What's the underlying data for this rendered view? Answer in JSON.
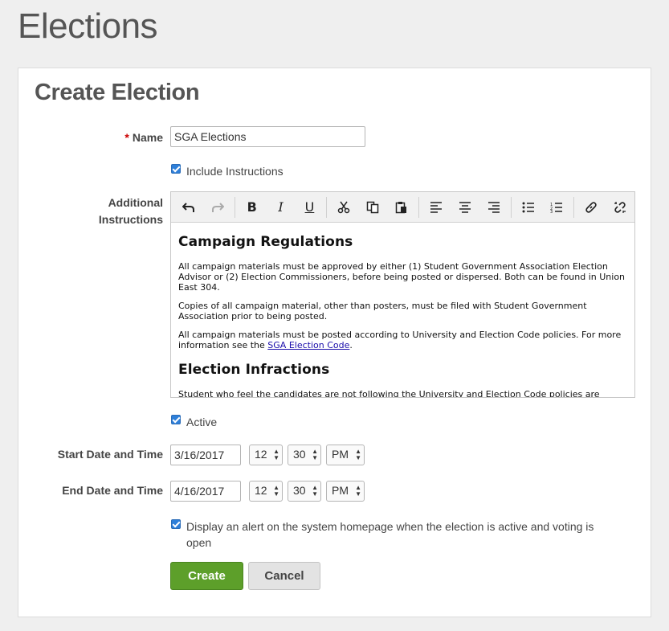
{
  "page": {
    "title": "Elections"
  },
  "form": {
    "title": "Create Election",
    "name": {
      "required_mark": "*",
      "label": "Name",
      "value": "SGA Elections"
    },
    "include_instructions": {
      "label": "Include Instructions",
      "checked": true
    },
    "additional_instructions": {
      "label_line1": "Additional",
      "label_line2": "Instructions",
      "toolbar": [
        "undo-icon",
        "redo-icon",
        "bold-icon",
        "italic-icon",
        "underline-icon",
        "cut-icon",
        "copy-icon",
        "paste-icon",
        "align-left-icon",
        "align-center-icon",
        "align-right-icon",
        "bullet-list-icon",
        "numbered-list-icon",
        "link-icon",
        "unlink-icon"
      ],
      "content": {
        "heading1": "Campaign Regulations",
        "p1": "All campaign materials must be approved by either (1) Student Government Association Election Advisor or (2) Election Commissioners, before being posted or dispersed. Both can be found in Union East 304.",
        "p2": "Copies of all campaign material, other than posters, must be filed with Student Government Association prior to being posted.",
        "p3_before": "All campaign materials must be posted according to University and Election Code policies. For more information see the ",
        "p3_link": "SGA Election Code",
        "p3_after": ".",
        "heading2": "Election Infractions",
        "p4": "Student who feel the candidates are not following the University and Election Code policies are"
      }
    },
    "active": {
      "label": "Active",
      "checked": true
    },
    "start": {
      "label": "Start Date and Time",
      "date": "3/16/2017",
      "hour": "12",
      "minute": "30",
      "ampm": "PM"
    },
    "end": {
      "label": "End Date and Time",
      "date": "4/16/2017",
      "hour": "12",
      "minute": "30",
      "ampm": "PM"
    },
    "alert": {
      "label_line1": "Display an alert on the system homepage when the election is active and voting is",
      "label_line2": "open",
      "checked": true
    },
    "buttons": {
      "create": "Create",
      "cancel": "Cancel"
    }
  },
  "colors": {
    "primary_button": "#5d9f2a",
    "checkbox": "#2e7fd9",
    "required": "#cc0000"
  }
}
